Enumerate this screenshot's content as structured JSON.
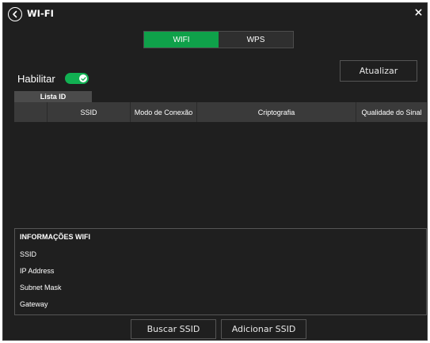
{
  "header": {
    "title": "WI-FI"
  },
  "tabs": [
    {
      "label": "WIFI",
      "active": true
    },
    {
      "label": "WPS",
      "active": false
    }
  ],
  "enable": {
    "label": "Habilitar",
    "enabled": true
  },
  "buttons": {
    "update": "Atualizar",
    "search_ssid": "Buscar SSID",
    "add_ssid": "Adicionar SSID"
  },
  "list": {
    "tag": "Lista ID",
    "columns": [
      "",
      "SSID",
      "Modo de Conexão",
      "Criptografia",
      "Qualidade do Sinal"
    ],
    "rows": []
  },
  "info": {
    "title": "INFORMAÇÕES WIFI",
    "fields": [
      "SSID",
      "IP Address",
      "Subnet Mask",
      "Gateway"
    ]
  },
  "colors": {
    "accent": "#0fa14a",
    "background": "#1f1f1f",
    "header_bg": "#3a3a3a"
  },
  "icons": {
    "back": "chevron-left-circle-icon",
    "close": "close-icon",
    "toggle_check": "check-icon"
  }
}
